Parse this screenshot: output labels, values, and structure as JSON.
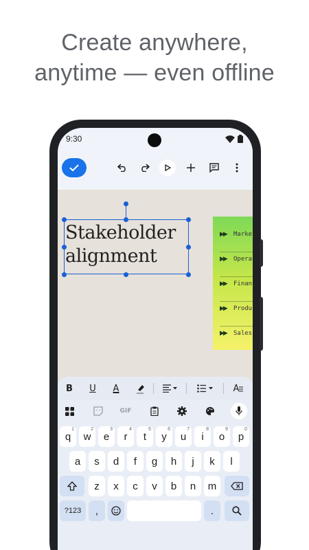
{
  "headline": {
    "line1": "Create anywhere,",
    "line2": "anytime — even offline"
  },
  "status": {
    "time": "9:30"
  },
  "canvas": {
    "title_line1": "Stakeholder",
    "title_line2": "alignment",
    "sticky_items": [
      "Marke",
      "Opera",
      "Finan",
      "Produ",
      "Sales"
    ]
  },
  "format_bar": {
    "bold": "B",
    "underline": "U",
    "text_color": "A",
    "text_style": "A"
  },
  "keyboard": {
    "tools": [
      "apps-icon",
      "sticker-icon",
      "gif-icon",
      "clipboard-icon",
      "settings-icon",
      "palette-icon",
      "mic-icon"
    ],
    "gif_label": "GIF",
    "row1": [
      "q",
      "w",
      "e",
      "r",
      "t",
      "y",
      "u",
      "i",
      "o",
      "p"
    ],
    "row1_hints": [
      "1",
      "2",
      "3",
      "4",
      "5",
      "6",
      "7",
      "8",
      "9",
      "0"
    ],
    "row2": [
      "a",
      "s",
      "d",
      "f",
      "g",
      "h",
      "j",
      "k",
      "l"
    ],
    "row3": [
      "z",
      "x",
      "c",
      "v",
      "b",
      "n",
      "m"
    ],
    "symbols_key": "?123",
    "comma_key": ",",
    "period_key": "."
  },
  "colors": {
    "accent": "#1a73e8",
    "appbar": "#f0f4fa",
    "canvas": "#e6e1da",
    "keyboard": "#e9eef6"
  }
}
